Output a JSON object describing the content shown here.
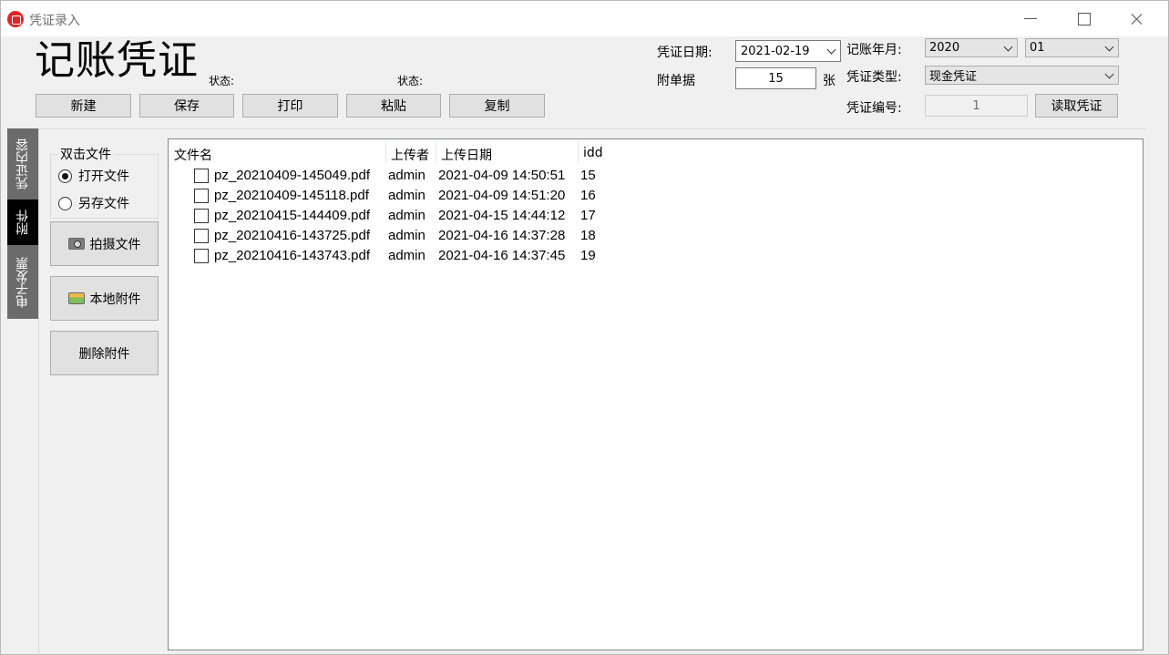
{
  "window": {
    "title": "凭证录入"
  },
  "header": {
    "big_title": "记账凭证",
    "status_label_1": "状态:",
    "status_label_2": "状态:",
    "buttons": {
      "new": "新建",
      "save": "保存",
      "print": "打印",
      "paste": "粘贴",
      "copy": "复制"
    },
    "voucher_date_label": "凭证日期:",
    "voucher_date_value": "2021-02-19",
    "attachment_label": "附单据",
    "attachment_count": "15",
    "attachment_unit": "张",
    "ledger_period_label": "记账年月:",
    "ledger_year": "2020",
    "ledger_month": "01",
    "voucher_type_label": "凭证类型:",
    "voucher_type_value": "现金凭证",
    "voucher_no_label": "凭证编号:",
    "voucher_no_value": "1",
    "read_voucher_button": "读取凭证"
  },
  "side_tabs": {
    "content": "凭证内容",
    "attachments": "附件",
    "e_invoice": "电子发票"
  },
  "left_panel": {
    "group_label": "双击文件",
    "radio_open": "打开文件",
    "radio_save_as": "另存文件",
    "radio_selected": "open",
    "capture_button": "拍摄文件",
    "local_button": "本地附件",
    "delete_button": "删除附件"
  },
  "file_list": {
    "columns": [
      "文件名",
      "上传者",
      "上传日期",
      "idd"
    ],
    "rows": [
      {
        "name": "pz_20210409-145049.pdf",
        "uploader": "admin",
        "date": "2021-04-09 14:50:51",
        "idd": "15",
        "checked": false
      },
      {
        "name": "pz_20210409-145118.pdf",
        "uploader": "admin",
        "date": "2021-04-09 14:51:20",
        "idd": "16",
        "checked": false
      },
      {
        "name": "pz_20210415-144409.pdf",
        "uploader": "admin",
        "date": "2021-04-15 14:44:12",
        "idd": "17",
        "checked": false
      },
      {
        "name": "pz_20210416-143725.pdf",
        "uploader": "admin",
        "date": "2021-04-16 14:37:28",
        "idd": "18",
        "checked": false
      },
      {
        "name": "pz_20210416-143743.pdf",
        "uploader": "admin",
        "date": "2021-04-16 14:37:45",
        "idd": "19",
        "checked": false
      }
    ]
  }
}
